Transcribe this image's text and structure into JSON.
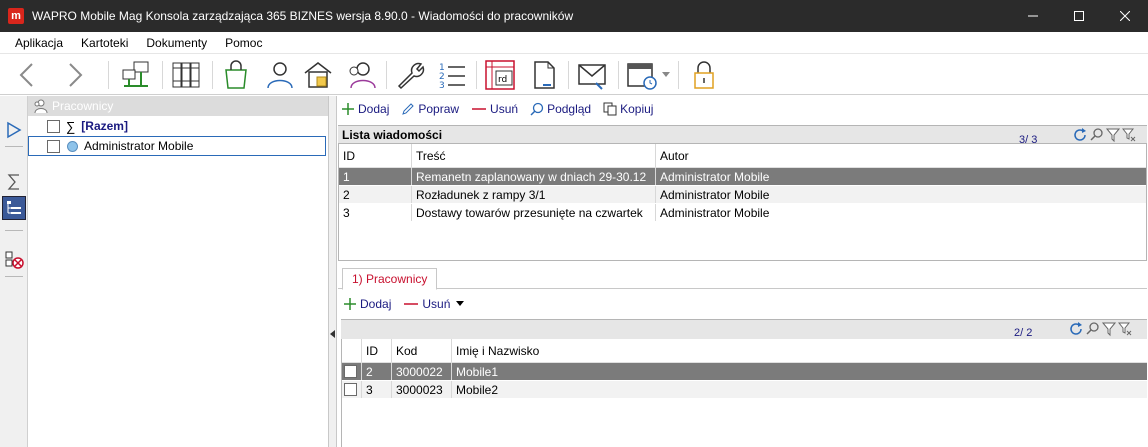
{
  "window": {
    "logo": "m",
    "title": "WAPRO Mobile Mag Konsola zarządzająca 365 BIZNES wersja 8.90.0 - Wiadomości do pracowników"
  },
  "menu": [
    "Aplikacja",
    "Kartoteki",
    "Dokumenty",
    "Pomoc"
  ],
  "toolbar": {
    "icons": [
      "back-arrow-icon",
      "forward-arrow-icon",
      "network-icon",
      "binders-icon",
      "shopping-bag-icon",
      "user-icon",
      "warehouse-icon",
      "users-icon",
      "wrench-icon",
      "numbered-list-icon",
      "rd-document-icon",
      "document-icon",
      "mail-icon",
      "calendar-icon",
      "lock-icon"
    ],
    "rd_label": "rd"
  },
  "tree": {
    "header": "Pracownicy",
    "items": [
      {
        "label": "[Razem]"
      },
      {
        "label": "Administrator Mobile"
      }
    ]
  },
  "actions": {
    "add": "Dodaj",
    "edit": "Popraw",
    "delete": "Usuń",
    "preview": "Podgląd",
    "copy": "Kopiuj"
  },
  "messages": {
    "title": "Lista wiadomości",
    "count": "3/ 3",
    "columns": [
      "ID",
      "Treść",
      "Autor"
    ],
    "rows": [
      {
        "id": "1",
        "content": "Remanetn zaplanowany w dniach 29-30.12",
        "author": "Administrator Mobile"
      },
      {
        "id": "2",
        "content": "Rozładunek z rampy 3/1",
        "author": "Administrator Mobile"
      },
      {
        "id": "3",
        "content": "Dostawy towarów przesunięte na czwartek",
        "author": "Administrator Mobile"
      }
    ]
  },
  "tab": {
    "label": "1) Pracownicy"
  },
  "sub_actions": {
    "add": "Dodaj",
    "delete": "Usuń"
  },
  "employees": {
    "count": "2/ 2",
    "columns": [
      "ID",
      "Kod",
      "Imię i Nazwisko"
    ],
    "rows": [
      {
        "id": "2",
        "code": "3000022",
        "name": "Mobile1"
      },
      {
        "id": "3",
        "code": "3000023",
        "name": "Mobile2"
      }
    ]
  },
  "colors": {
    "titlebar": "#2b2b2b",
    "logo": "#d9261c",
    "selected_row": "#7b7b7b",
    "action_text": "#1a1a80",
    "tab_text": "#c8102e"
  }
}
